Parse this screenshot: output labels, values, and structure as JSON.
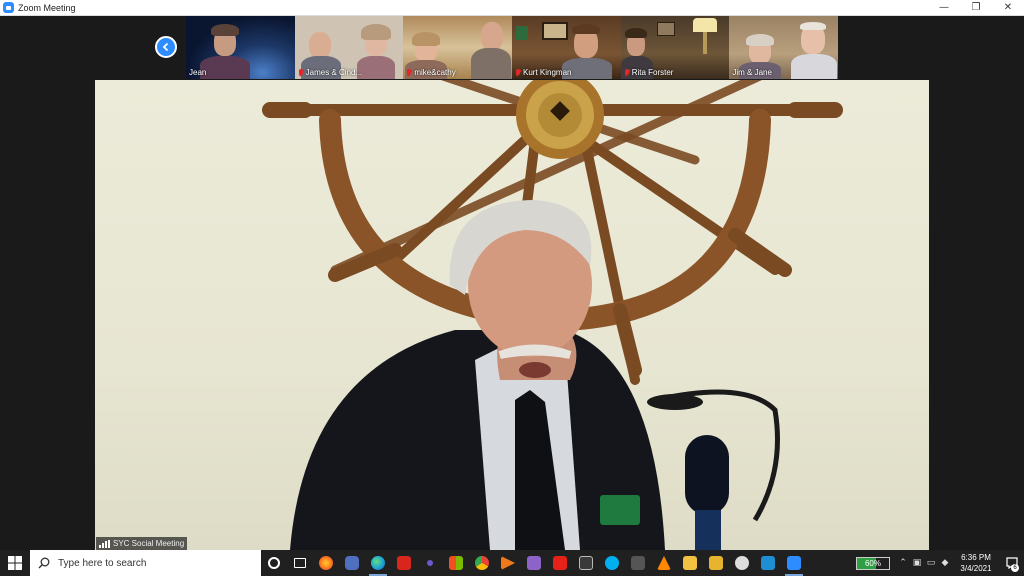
{
  "window": {
    "title": "Zoom Meeting",
    "minimize": "—",
    "restore": "❐",
    "close": "✕"
  },
  "gallery": {
    "participants": [
      {
        "name": "Jean",
        "muted": false
      },
      {
        "name": "James & Cind...",
        "muted": true
      },
      {
        "name": "mike&cathy",
        "muted": true
      },
      {
        "name": "Kurt Kingman",
        "muted": true
      },
      {
        "name": "Rita Forster",
        "muted": true
      },
      {
        "name": "Jim & Jane",
        "muted": false
      }
    ]
  },
  "main": {
    "meeting_name": "SYC Social Meeting"
  },
  "taskbar": {
    "search_placeholder": "Type here to search",
    "battery_percent": "60%",
    "time": "6:36 PM",
    "date": "3/4/2021",
    "notification_count": "6",
    "icons": [
      "windows-start-icon",
      "search-icon",
      "cortana-icon",
      "task-view-icon",
      "firefox-icon",
      "chat-icon",
      "edge-icon",
      "acrobat-icon",
      "teams-icon",
      "store-icon",
      "chrome-icon",
      "media-player-icon",
      "photos-icon",
      "hd-youtube-icon",
      "calculator-icon",
      "skype-icon",
      "app-icon",
      "vlc-icon",
      "file-explorer-icon",
      "mail-icon",
      "t-app-icon",
      "sway-icon",
      "zoom-icon"
    ]
  },
  "colors": {
    "zoom_blue": "#2d8cff",
    "battery_green": "#2ea043",
    "taskbar": "#202020"
  }
}
